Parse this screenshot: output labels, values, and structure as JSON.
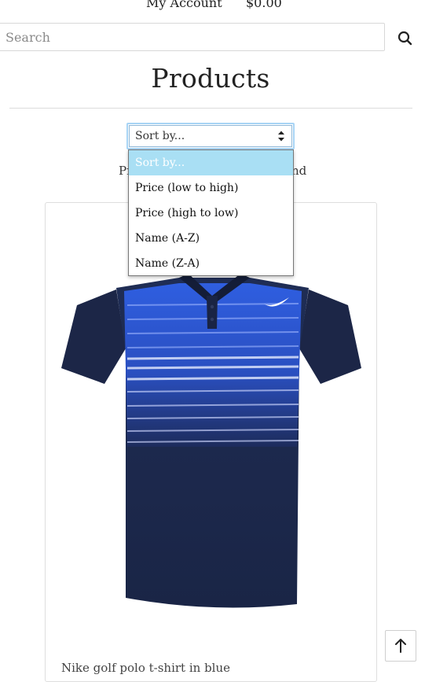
{
  "header": {
    "account_label": "My Account",
    "cart_total": "$0.00"
  },
  "search": {
    "placeholder": "Search",
    "icon": "search-icon"
  },
  "page": {
    "title": "Products"
  },
  "sort": {
    "selected": "Sort by...",
    "options": [
      "Sort by...",
      "Price (low to high)",
      "Price (high to low)",
      "Name (A-Z)",
      "Name (Z-A)"
    ],
    "highlight_color": "#a9dff4"
  },
  "hidden_text": {
    "left": "Pr",
    "right": "nd"
  },
  "products": [
    {
      "name": "Nike golf polo t-shirt in blue"
    }
  ],
  "scroll_top": {
    "icon": "arrow-up-icon"
  }
}
